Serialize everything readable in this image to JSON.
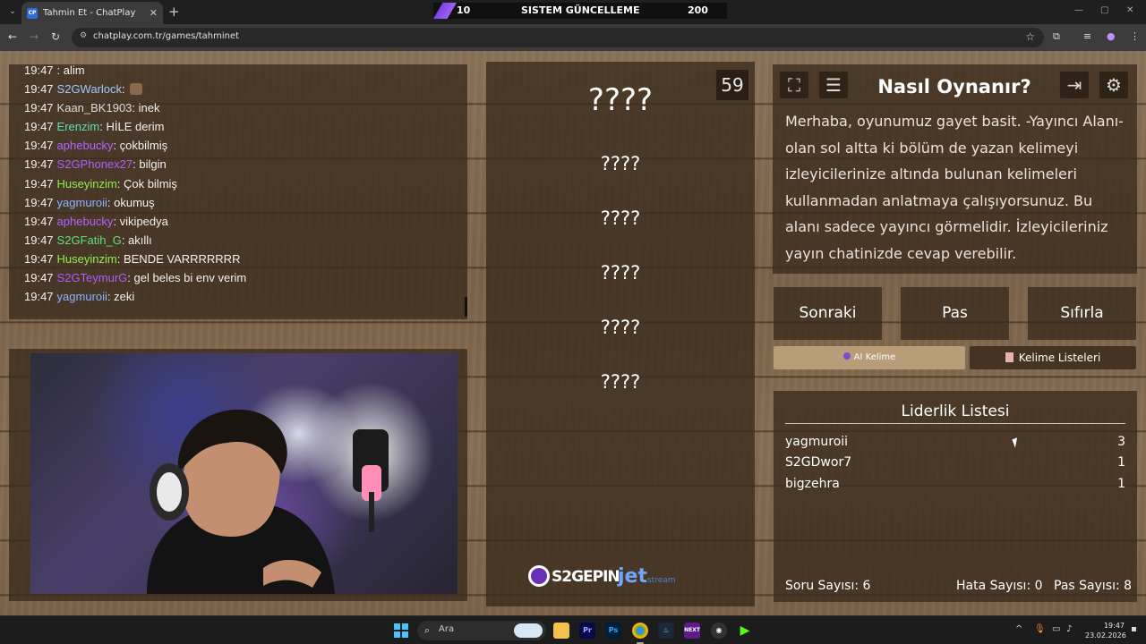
{
  "browser": {
    "tab_title": "Tahmin Et - ChatPlay",
    "tab_favicon": "CP",
    "url": "chatplay.com.tr/games/tahminet",
    "banner": {
      "left_value": "10",
      "title": "SISTEM GÜNCELLEME",
      "right_value": "200"
    }
  },
  "chat": {
    "messages": [
      {
        "time": "19:47",
        "user": "",
        "user_color": "#e04848",
        "text": ": alim"
      },
      {
        "time": "19:47",
        "user": "S2GWarlock",
        "user_color": "#9ec9ff",
        "text": ":",
        "emote": true
      },
      {
        "time": "19:47",
        "user": "Kaan_BK1903",
        "user_color": "#dcdcdc",
        "text": ": inek"
      },
      {
        "time": "19:47",
        "user": "Erenzim",
        "user_color": "#5fe0b0",
        "text": ": HİLE derim"
      },
      {
        "time": "19:47",
        "user": "aphebucky",
        "user_color": "#b066ff",
        "text": ": çokbilmiş"
      },
      {
        "time": "19:47",
        "user": "S2GPhonex27",
        "user_color": "#b45cff",
        "text": ": bilgin"
      },
      {
        "time": "19:47",
        "user": "Huseyinzim",
        "user_color": "#8df04a",
        "text": ": Çok bilmiş"
      },
      {
        "time": "19:47",
        "user": "yagmuroii",
        "user_color": "#8ab4ff",
        "text": ": okumuş"
      },
      {
        "time": "19:47",
        "user": "aphebucky",
        "user_color": "#b066ff",
        "text": ": vikipedya"
      },
      {
        "time": "19:47",
        "user": "S2GFatih_G",
        "user_color": "#5fe07a",
        "text": ": akıllı"
      },
      {
        "time": "19:47",
        "user": "Huseyinzim",
        "user_color": "#8df04a",
        "text": ": BENDE VARRRRRRR"
      },
      {
        "time": "19:47",
        "user": "S2GTeymurG",
        "user_color": "#b45cff",
        "text": ": gel beles bi env verim"
      },
      {
        "time": "19:47",
        "user": "yagmuroii",
        "user_color": "#8ab4ff",
        "text": ": zeki"
      }
    ]
  },
  "game": {
    "timer": "59",
    "words": [
      "????",
      "????",
      "????",
      "????",
      "????",
      "????"
    ],
    "sponsors": {
      "s2g": "S2GEPIN",
      "jet": "jet",
      "jet_sub": "stream"
    }
  },
  "howto": {
    "title": "Nasıl Oynanır?",
    "text": "Merhaba, oyunumuz gayet basit. -Yayıncı Alanı- olan sol altta ki bölüm de yazan kelimeyi izleyicilerinize altında bulunan kelimeleri kullanmadan anlatmaya çalışıyorsunuz. Bu alanı sadece yayıncı görmelidir. İzleyicileriniz yayın chatinizde cevap verebilir."
  },
  "controls": {
    "next": "Sonraki",
    "pass": "Pas",
    "reset": "Sıfırla",
    "ai_tab": "AI Kelime",
    "lists_tab": "Kelime Listeleri"
  },
  "leaderboard": {
    "title": "Liderlik Listesi",
    "rows": [
      {
        "name": "yagmuroii",
        "score": "3"
      },
      {
        "name": "S2GDwor7",
        "score": "1"
      },
      {
        "name": "bigzehra",
        "score": "1"
      }
    ],
    "question_count": "Soru Sayısı: 6",
    "error_count": "Hata Sayısı: 0",
    "pass_count": "Pas Sayısı: 8"
  },
  "taskbar": {
    "search_placeholder": "Ara",
    "time": "19:47",
    "date": "23.02.2026"
  },
  "colors": {
    "panel": "#3a2a1c",
    "active_tab": "#b99c78",
    "accent_purple": "#6a2bd9"
  }
}
